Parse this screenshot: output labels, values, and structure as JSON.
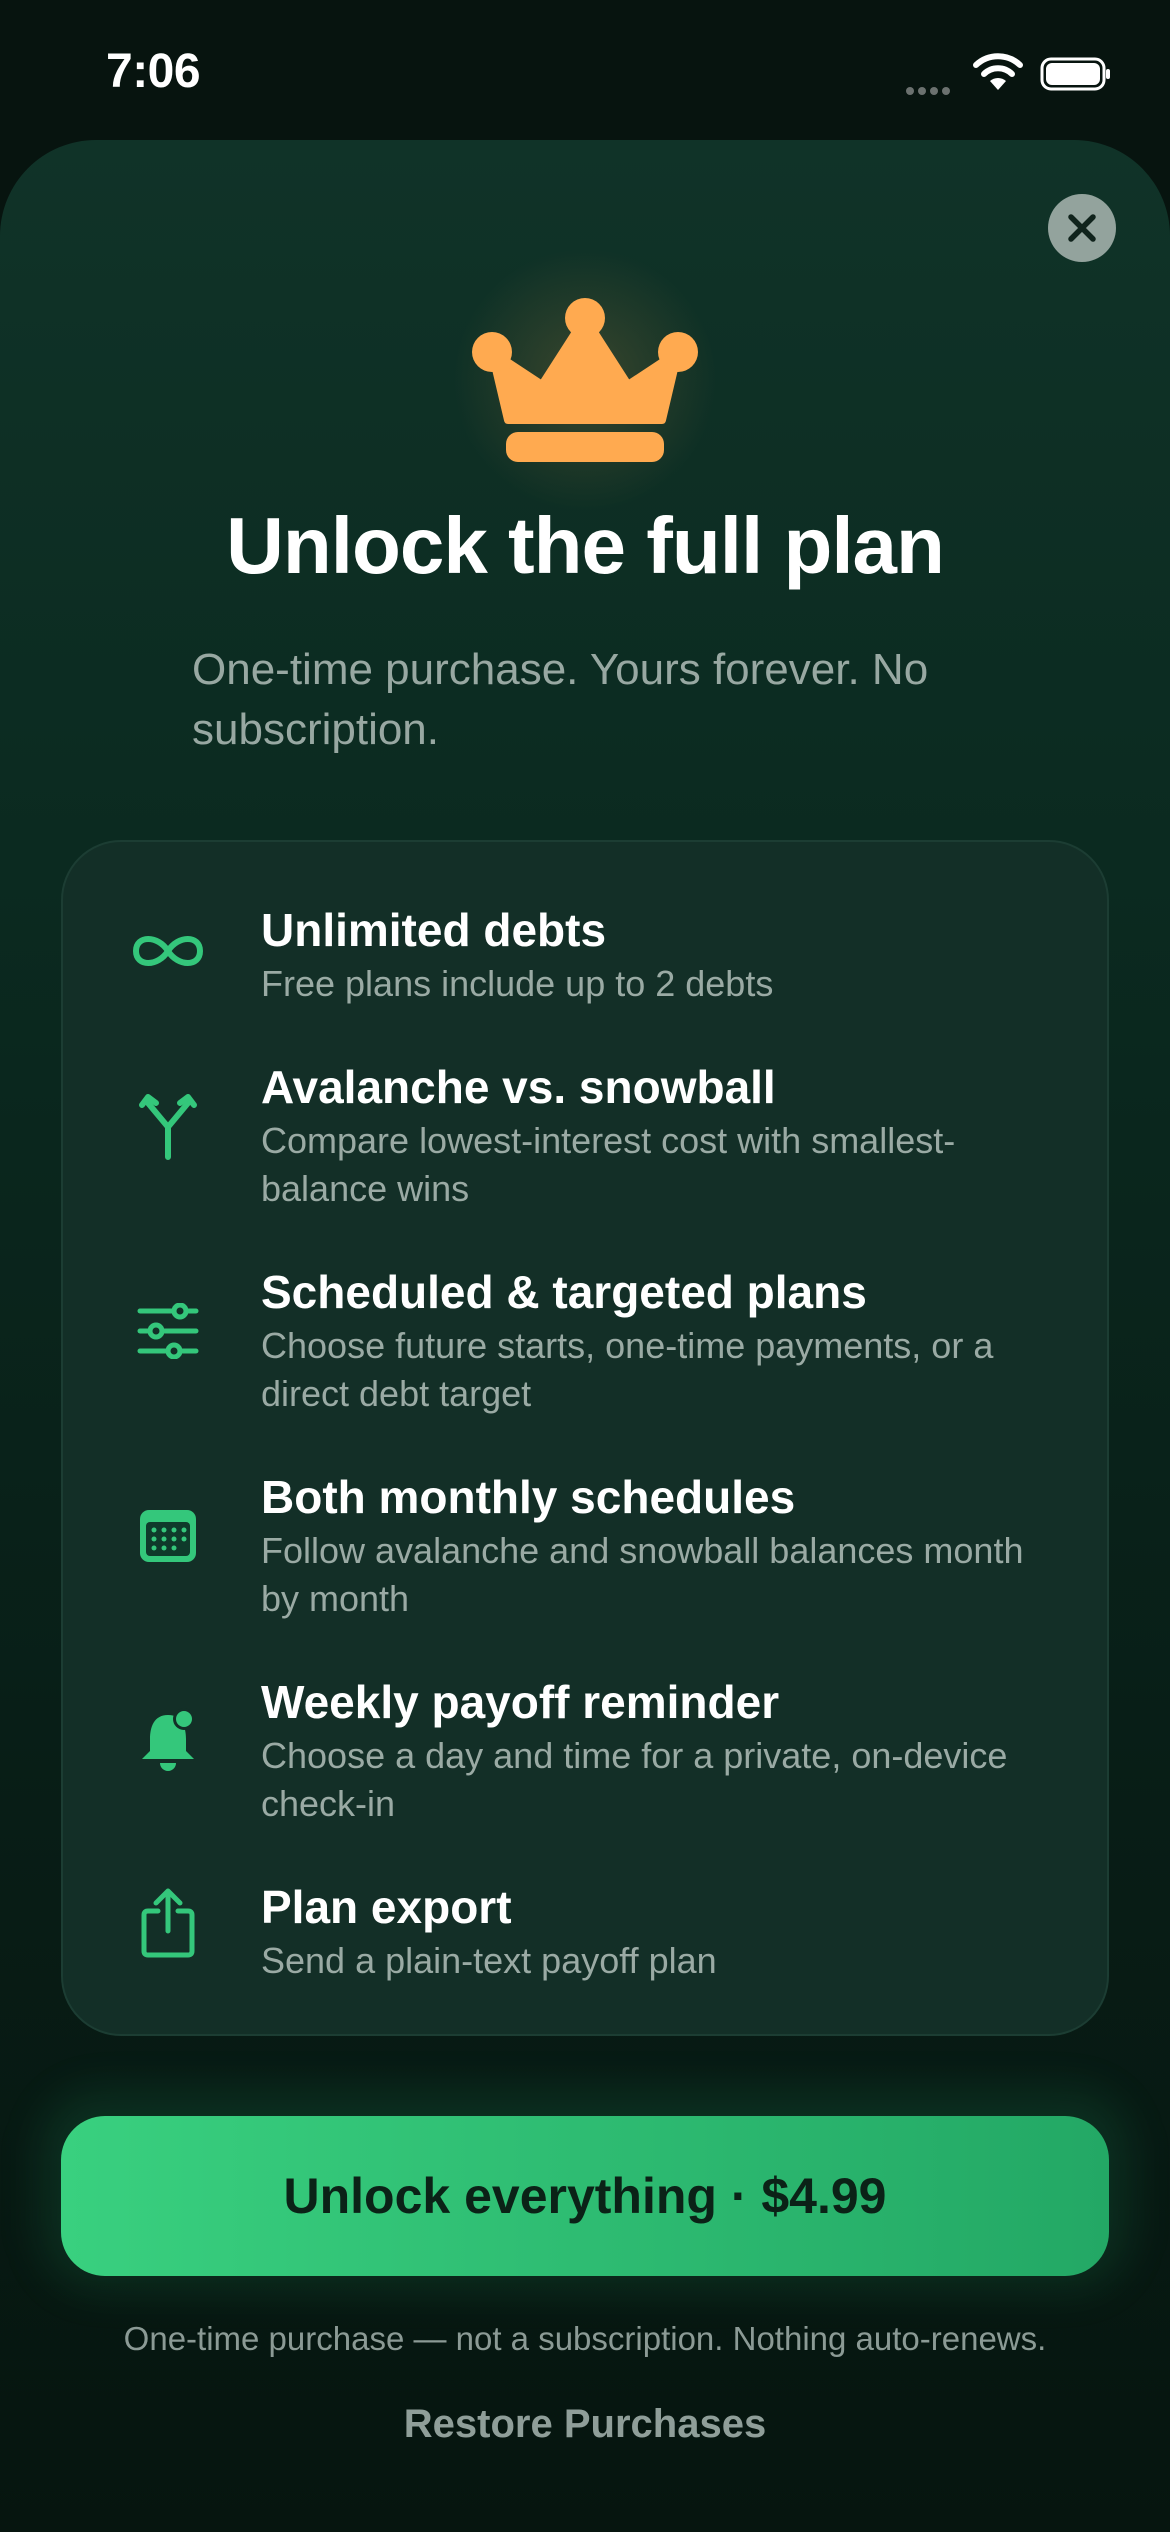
{
  "status_bar": {
    "time": "7:06",
    "icons": [
      "cellular-dots-icon",
      "wifi-icon",
      "battery-icon"
    ]
  },
  "paywall": {
    "close_icon": "close-icon",
    "hero_icon": "crown-icon",
    "title": "Unlock the full plan",
    "subtitle": "One-time purchase. Yours forever. No subscription.",
    "features": [
      {
        "icon": "infinity-icon",
        "title": "Unlimited debts",
        "description": "Free plans include up to 2 debts"
      },
      {
        "icon": "split-arrows-icon",
        "title": "Avalanche vs. snowball",
        "description": "Compare lowest-interest cost with smallest-balance wins"
      },
      {
        "icon": "sliders-icon",
        "title": "Scheduled & targeted plans",
        "description": "Choose future starts, one-time payments, or a direct debt target"
      },
      {
        "icon": "calendar-icon",
        "title": "Both monthly schedules",
        "description": "Follow avalanche and snowball balances month by month"
      },
      {
        "icon": "bell-badge-icon",
        "title": "Weekly payoff reminder",
        "description": "Choose a day and time for a private, on-device check-in"
      },
      {
        "icon": "share-icon",
        "title": "Plan export",
        "description": "Send a plain-text payoff plan"
      }
    ],
    "cta_label": "Unlock everything · $4.99",
    "fine_print": "One-time purchase — not a subscription. Nothing auto-renews.",
    "restore_label": "Restore Purchases"
  },
  "colors": {
    "accent_green": "#34C77B",
    "crown_orange": "#FFAA50",
    "background": "#0B2A20"
  }
}
